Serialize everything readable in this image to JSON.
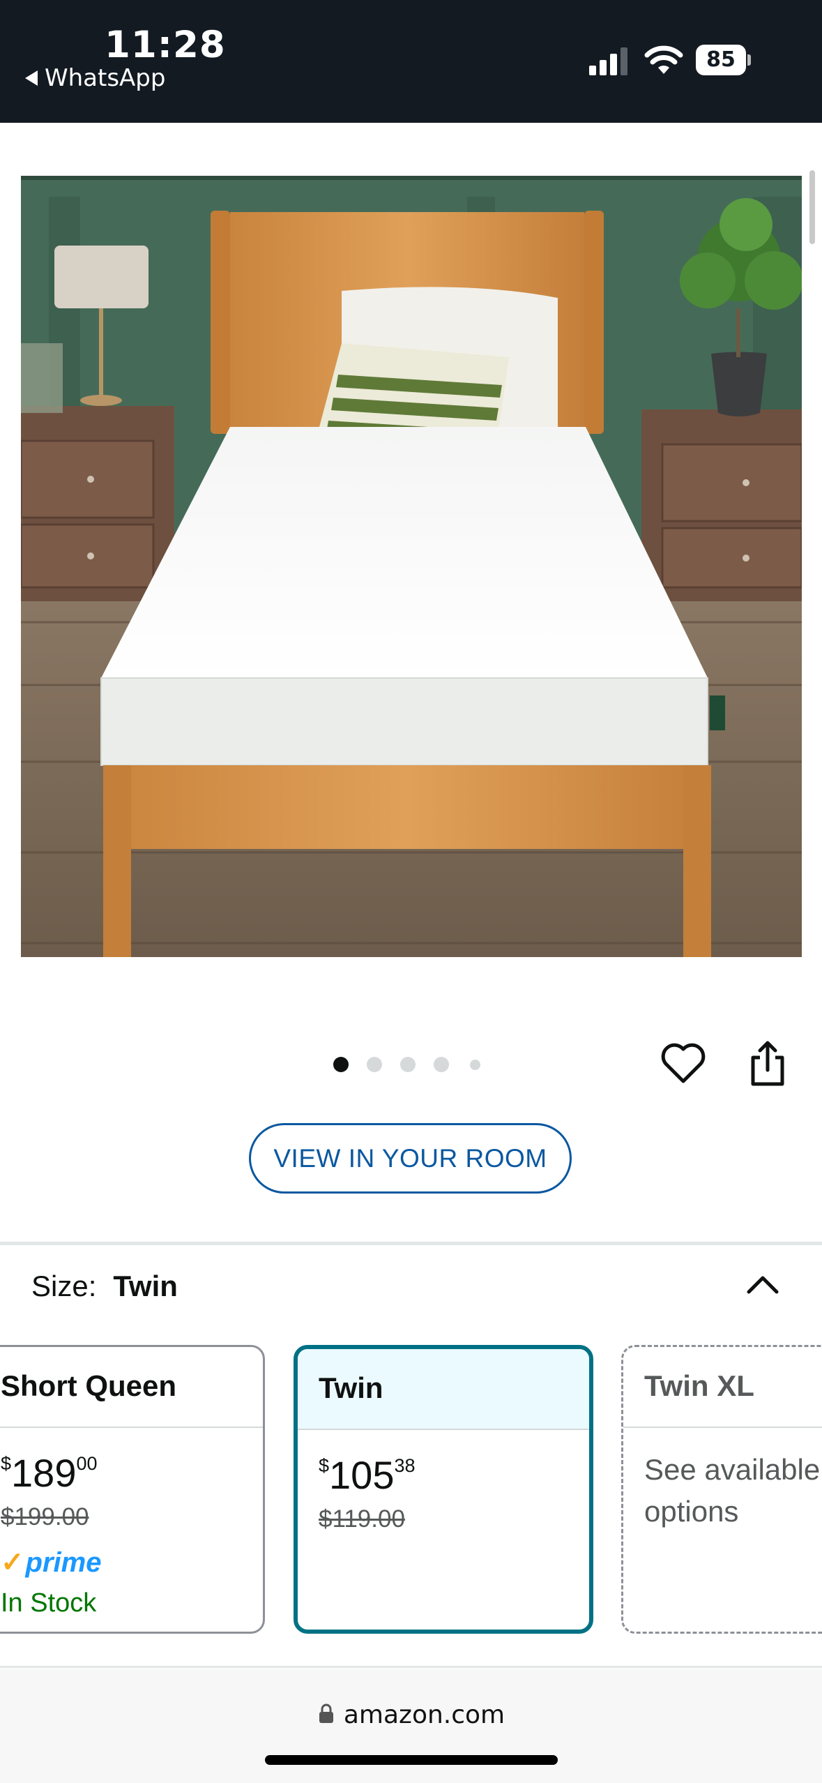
{
  "status_bar": {
    "time": "11:28",
    "back_app": "WhatsApp",
    "battery": "85"
  },
  "gallery": {
    "image_count": 5,
    "active_index": 0
  },
  "actions": {
    "view_in_room": "VIEW IN YOUR ROOM"
  },
  "size_selector": {
    "label": "Size:",
    "selected": "Twin",
    "options": [
      {
        "name": "Short Queen",
        "price_sym": "$",
        "price_whole": "189",
        "price_frac": "00",
        "list_price": "$199.00",
        "prime": "prime",
        "stock": "In Stock"
      },
      {
        "name": "Twin",
        "price_sym": "$",
        "price_whole": "105",
        "price_frac": "38",
        "list_price": "$119.00"
      },
      {
        "name": "Twin XL",
        "note": "See available options"
      }
    ]
  },
  "browser": {
    "url": "amazon.com"
  },
  "colors": {
    "accent": "#007185",
    "link": "#0a58a0",
    "prime": "#1a98ff",
    "stock": "#007600"
  }
}
